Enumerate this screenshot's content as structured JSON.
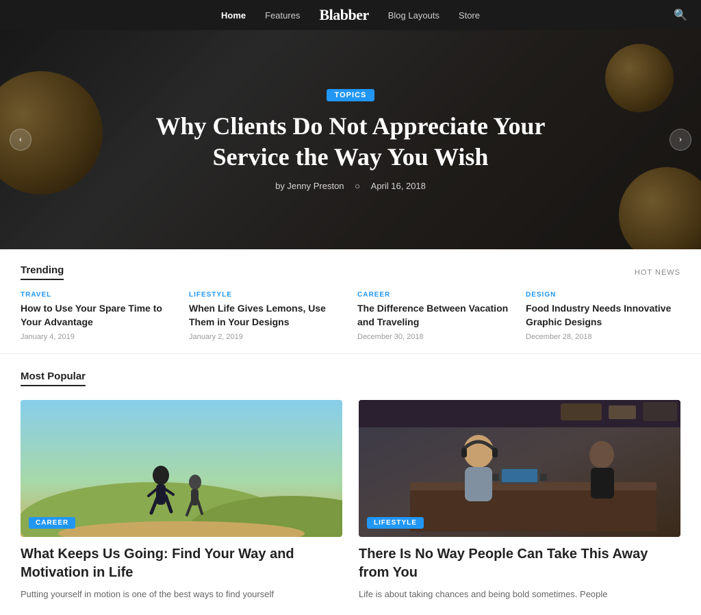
{
  "nav": {
    "links": [
      {
        "label": "Home",
        "active": true
      },
      {
        "label": "Features",
        "active": false
      },
      {
        "label": "Blog Layouts",
        "active": false
      },
      {
        "label": "Store",
        "active": false
      }
    ],
    "logo": "Blabber",
    "search_icon": "🔍"
  },
  "hero": {
    "badge": "TOPICS",
    "title": "Why Clients Do Not Appreciate Your Service the Way You Wish",
    "author": "by Jenny Preston",
    "date": "April 16, 2018",
    "prev_icon": "‹",
    "next_icon": "›"
  },
  "trending": {
    "section_title": "Trending",
    "hot_news_label": "HOT NEWS",
    "items": [
      {
        "category": "TRAVEL",
        "title": "How to Use Your Spare Time to Your Advantage",
        "date": "January 4, 2019"
      },
      {
        "category": "LIFESTYLE",
        "title": "When Life Gives Lemons, Use Them in Your Designs",
        "date": "January 2, 2019"
      },
      {
        "category": "CAREER",
        "title": "The Difference Between Vacation and Traveling",
        "date": "December 30, 2018"
      },
      {
        "category": "DESIGN",
        "title": "Food Industry Needs Innovative Graphic Designs",
        "date": "December 28, 2018"
      }
    ]
  },
  "popular": {
    "section_title": "Most Popular",
    "cards": [
      {
        "badge": "CAREER",
        "title": "What Keeps Us Going: Find Your Way and Motivation in Life",
        "excerpt": "Putting yourself in motion is one of the best ways to find yourself",
        "img_type": "running"
      },
      {
        "badge": "LIFESTYLE",
        "title": "There Is No Way People Can Take This Away from You",
        "excerpt": "Life is about taking chances and being bold sometimes. People",
        "img_type": "studio"
      }
    ]
  }
}
